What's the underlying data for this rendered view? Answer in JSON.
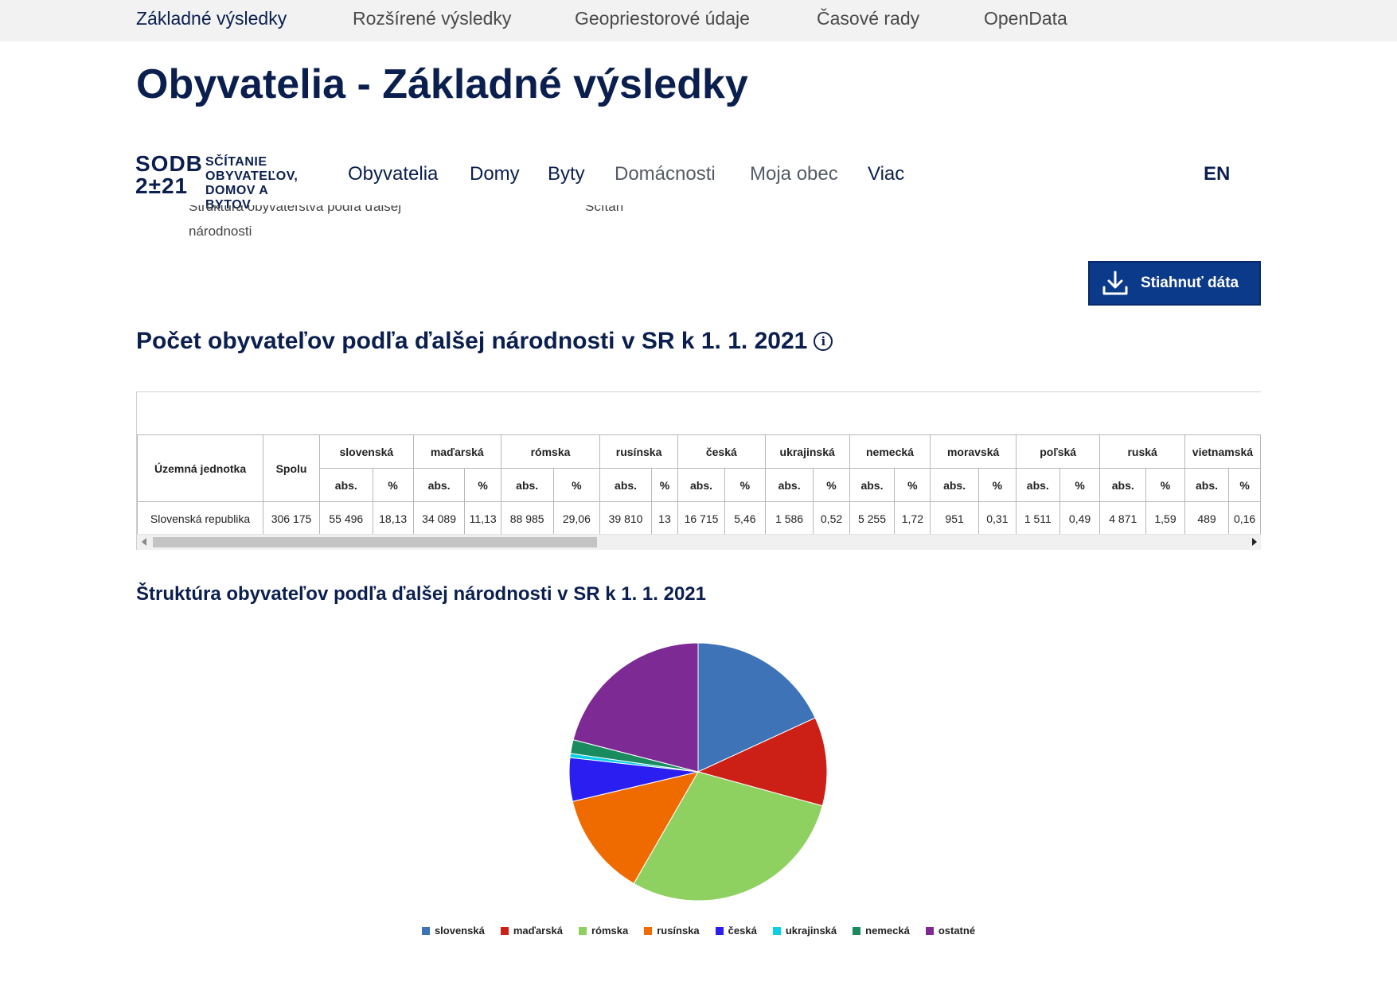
{
  "top_tabs": [
    "Základné výsledky",
    "Rozšírené výsledky",
    "Geopriestorové údaje",
    "Časové rady",
    "OpenData"
  ],
  "page_title": "Obyvatelia - Základné výsledky",
  "logo": {
    "mark_line1": "SODB",
    "mark_line2": "2±21",
    "text_line1": "SČÍTANIE",
    "text_line2": "OBYVATEĽOV,",
    "text_line3": "DOMOV A BYTOV"
  },
  "main_nav": [
    "Obyvatelia",
    "Domy",
    "Byty",
    "Domácnosti",
    "Moja obec",
    "Viac"
  ],
  "lang": "EN",
  "breadcrumb_fragment": "národnosti",
  "download_label": "Stiahnuť dáta",
  "table_title": "Počet obyvateľov podľa ďalšej národnosti v SR k 1. 1. 2021",
  "table": {
    "col_unit": "Územná jednotka",
    "col_total": "Spolu",
    "groups": [
      "slovenská",
      "maďarská",
      "rómska",
      "rusínska",
      "česká",
      "ukrajinská",
      "nemecká",
      "moravská",
      "poľská",
      "ruská",
      "vietnamská"
    ],
    "sub_abs": "abs.",
    "sub_pct": "%",
    "rows": [
      {
        "unit": "Slovenská republika",
        "total": "306 175",
        "values": [
          [
            "55 496",
            "18,13"
          ],
          [
            "34 089",
            "11,13"
          ],
          [
            "88 985",
            "29,06"
          ],
          [
            "39 810",
            "13"
          ],
          [
            "16 715",
            "5,46"
          ],
          [
            "1 586",
            "0,52"
          ],
          [
            "5 255",
            "1,72"
          ],
          [
            "951",
            "0,31"
          ],
          [
            "1 511",
            "0,49"
          ],
          [
            "4 871",
            "1,59"
          ],
          [
            "489",
            "0,16"
          ]
        ]
      }
    ]
  },
  "chart_title": "Štruktúra obyvateľov podľa ďalšej národnosti v SR k 1. 1. 2021",
  "chart_data": {
    "type": "pie",
    "title": "Štruktúra obyvateľov podľa ďalšej národnosti v SR k 1. 1. 2021",
    "categories": [
      "slovenská",
      "maďarská",
      "rómska",
      "rusínska",
      "česká",
      "ukrajinská",
      "nemecká",
      "ostatné"
    ],
    "values": [
      18.13,
      11.13,
      29.06,
      13.0,
      5.46,
      0.52,
      1.72,
      21.0
    ],
    "colors": [
      "#3f73b8",
      "#cc1f16",
      "#8fd161",
      "#ef6b00",
      "#2b1ef0",
      "#0ad0e6",
      "#1a8a5f",
      "#7e2a94"
    ],
    "legend_position": "bottom"
  }
}
